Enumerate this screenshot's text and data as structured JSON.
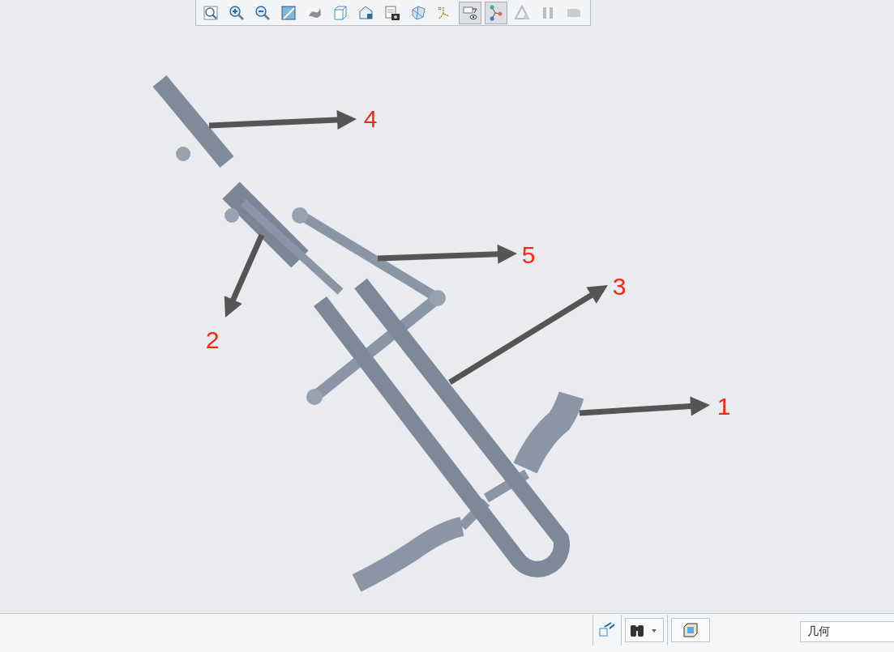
{
  "toolbar": {
    "buttons": [
      {
        "kind": "zoom-fit",
        "selected": false
      },
      {
        "kind": "zoom-in",
        "selected": false
      },
      {
        "kind": "zoom-out",
        "selected": false
      },
      {
        "kind": "repaint",
        "selected": false
      },
      {
        "kind": "display-style",
        "selected": false
      },
      {
        "kind": "view",
        "selected": false
      },
      {
        "kind": "saved-views",
        "selected": false
      },
      {
        "kind": "view-manager",
        "selected": false
      },
      {
        "kind": "perspective",
        "selected": false
      },
      {
        "kind": "datum-display",
        "selected": false
      },
      {
        "kind": "annotation-display",
        "selected": true
      },
      {
        "kind": "connections",
        "selected": true
      },
      {
        "kind": "triangle",
        "selected": false
      },
      {
        "kind": "pause",
        "selected": false
      },
      {
        "kind": "stop",
        "selected": false
      }
    ]
  },
  "callouts": [
    {
      "label": "4"
    },
    {
      "label": "5"
    },
    {
      "label": "3"
    },
    {
      "label": "2"
    },
    {
      "label": "1"
    }
  ],
  "status_bar": {
    "filter": {
      "value": "几何"
    }
  }
}
